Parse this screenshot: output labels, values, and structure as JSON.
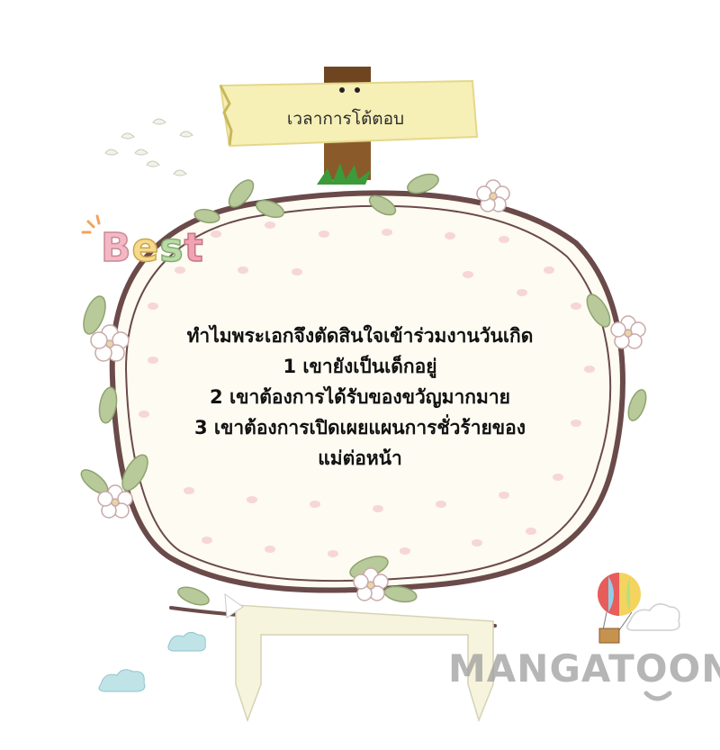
{
  "sign": {
    "label": "เวลาการโต้ตอบ"
  },
  "question": {
    "lines": [
      "ทำไมพระเอกจึงตัดสินใจเข้าร่วมงานวันเกิด",
      "1 เขายังเป็นเด็กอยู่",
      "2 เขาต้องการได้รับของขวัญมากมาย",
      "3 เขาต้องการเปิดเผยแผนการชั่วร้ายของ",
      "แม่ต่อหน้า"
    ]
  },
  "decoration": {
    "best_letters": [
      "B",
      "e",
      "s",
      "t"
    ],
    "best_colors": [
      "#f4b8c4",
      "#f6d98a",
      "#b9dca6",
      "#f2a3b3"
    ]
  },
  "watermark": {
    "text": "MANGATOON"
  },
  "colors": {
    "branch": "#6b4a4a",
    "leaf": "#b8c99a",
    "frame_fill": "#fdfbf2",
    "dot": "#f7d6d6",
    "sign_board": "#f6efb6",
    "sign_post": "#8a5a2b",
    "grass": "#3c9a3a"
  }
}
